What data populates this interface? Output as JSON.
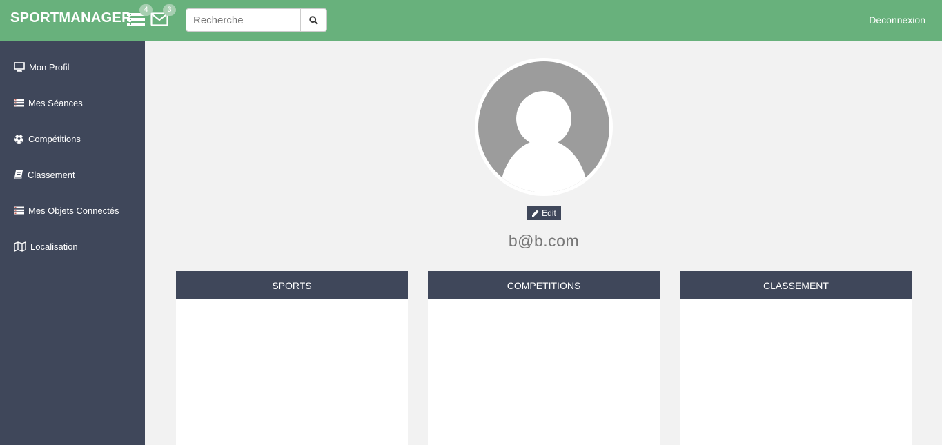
{
  "header": {
    "brand": "SPORTMANAGER",
    "sessions_badge": "4",
    "messages_badge": "3",
    "search_placeholder": "Recherche",
    "logout_label": "Deconnexion",
    "color": "#68b17c"
  },
  "sidebar": {
    "color": "#3f475a",
    "items": [
      {
        "label": "Mon Profil",
        "icon": "monitor-icon"
      },
      {
        "label": "Mes Séances",
        "icon": "list-icon"
      },
      {
        "label": "Compétitions",
        "icon": "soccer-ball-icon"
      },
      {
        "label": "Classement",
        "icon": "book-icon"
      },
      {
        "label": "Mes Objets Connectés",
        "icon": "list-icon"
      },
      {
        "label": "Localisation",
        "icon": "map-icon"
      }
    ]
  },
  "profile": {
    "edit_label": "Edit",
    "email": "b@b.com"
  },
  "cards": [
    {
      "title": "SPORTS"
    },
    {
      "title": "COMPETITIONS"
    },
    {
      "title": "CLASSEMENT"
    }
  ]
}
